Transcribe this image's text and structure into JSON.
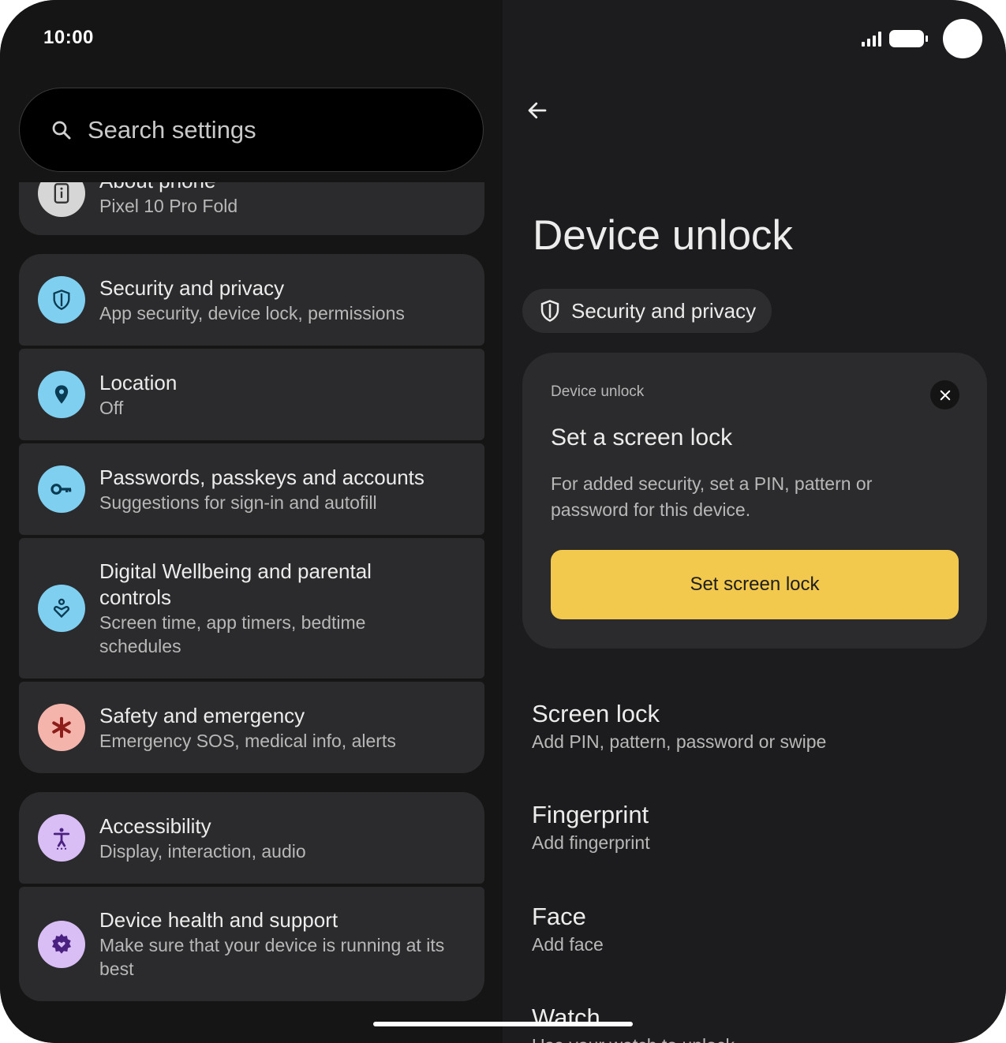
{
  "status_bar": {
    "time": "10:00"
  },
  "search": {
    "placeholder": "Search settings"
  },
  "settings_list": [
    {
      "title": "About phone",
      "subtitle": "Pixel 10 Pro Fold",
      "icon": "info-icon",
      "icon_bg": "#d6d6d6",
      "icon_fg": "#333333"
    },
    {
      "title": "Security and privacy",
      "subtitle": "App security, device lock, permissions",
      "icon": "shield-icon",
      "icon_bg": "#7fcff0",
      "icon_fg": "#0b3b52"
    },
    {
      "title": "Location",
      "subtitle": "Off",
      "icon": "location-pin-icon",
      "icon_bg": "#7fcff0",
      "icon_fg": "#0b3b52"
    },
    {
      "title": "Passwords, passkeys and accounts",
      "subtitle": "Suggestions for sign-in and autofill",
      "icon": "key-icon",
      "icon_bg": "#7fcff0",
      "icon_fg": "#0b3b52"
    },
    {
      "title": "Digital Wellbeing and parental controls",
      "subtitle": "Screen time, app timers, bedtime schedules",
      "icon": "wellbeing-icon",
      "icon_bg": "#7fcff0",
      "icon_fg": "#0b3b52"
    },
    {
      "title": "Safety and emergency",
      "subtitle": "Emergency SOS, medical info, alerts",
      "icon": "asterisk-icon",
      "icon_bg": "#f5b4ab",
      "icon_fg": "#8c1d18"
    },
    {
      "title": "Accessibility",
      "subtitle": "Display, interaction, audio",
      "icon": "accessibility-icon",
      "icon_bg": "#d9bdf5",
      "icon_fg": "#4a2180"
    },
    {
      "title": "Device health and support",
      "subtitle": "Make sure that your device is running at its best",
      "icon": "health-gear-icon",
      "icon_bg": "#d9bdf5",
      "icon_fg": "#4a2180"
    }
  ],
  "detail": {
    "title": "Device unlock",
    "chip_label": "Security and privacy",
    "tip": {
      "eyebrow": "Device unlock",
      "title": "Set a screen lock",
      "body": "For added security, set a PIN, pattern or password for this device.",
      "button": "Set screen lock",
      "button_color": "#f2c94c"
    },
    "prefs": [
      {
        "title": "Screen lock",
        "subtitle": "Add PIN, pattern, password or swipe"
      },
      {
        "title": "Fingerprint",
        "subtitle": "Add fingerprint"
      },
      {
        "title": "Face",
        "subtitle": "Add face"
      },
      {
        "title": "Watch",
        "subtitle": "Use your watch to unlock"
      }
    ]
  },
  "colors": {
    "background": "#151515",
    "card": "#2b2b2d",
    "accent": "#f2c94c"
  }
}
